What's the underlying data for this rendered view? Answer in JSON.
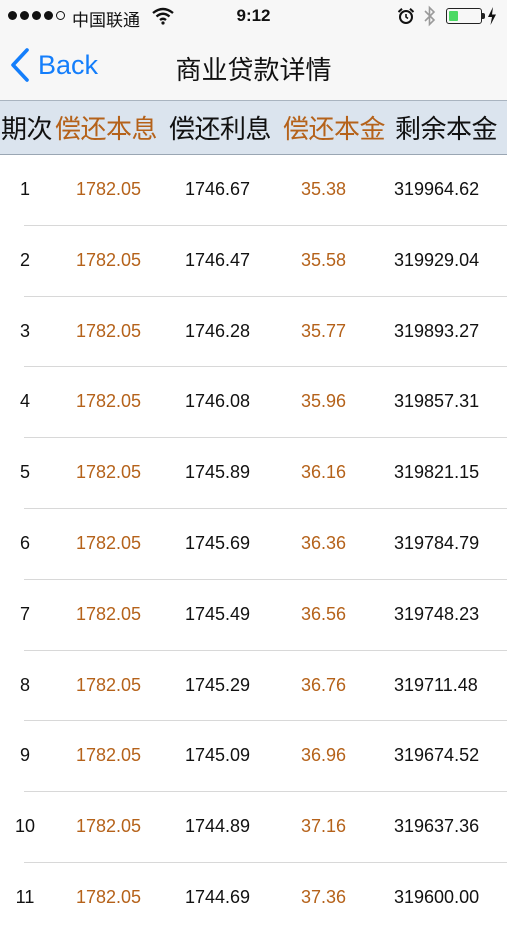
{
  "status_bar": {
    "carrier": "中国联通",
    "time": "9:12"
  },
  "nav": {
    "back_label": "Back",
    "title": "商业贷款详情"
  },
  "table": {
    "headers": {
      "period": "期次",
      "payment": "偿还本息",
      "interest": "偿还利息",
      "principal": "偿还本金",
      "remaining": "剩余本金"
    },
    "rows": [
      {
        "period": "1",
        "payment": "1782.05",
        "interest": "1746.67",
        "principal": "35.38",
        "remaining": "319964.62"
      },
      {
        "period": "2",
        "payment": "1782.05",
        "interest": "1746.47",
        "principal": "35.58",
        "remaining": "319929.04"
      },
      {
        "period": "3",
        "payment": "1782.05",
        "interest": "1746.28",
        "principal": "35.77",
        "remaining": "319893.27"
      },
      {
        "period": "4",
        "payment": "1782.05",
        "interest": "1746.08",
        "principal": "35.96",
        "remaining": "319857.31"
      },
      {
        "period": "5",
        "payment": "1782.05",
        "interest": "1745.89",
        "principal": "36.16",
        "remaining": "319821.15"
      },
      {
        "period": "6",
        "payment": "1782.05",
        "interest": "1745.69",
        "principal": "36.36",
        "remaining": "319784.79"
      },
      {
        "period": "7",
        "payment": "1782.05",
        "interest": "1745.49",
        "principal": "36.56",
        "remaining": "319748.23"
      },
      {
        "period": "8",
        "payment": "1782.05",
        "interest": "1745.29",
        "principal": "36.76",
        "remaining": "319711.48"
      },
      {
        "period": "9",
        "payment": "1782.05",
        "interest": "1745.09",
        "principal": "36.96",
        "remaining": "319674.52"
      },
      {
        "period": "10",
        "payment": "1782.05",
        "interest": "1744.89",
        "principal": "37.16",
        "remaining": "319637.36"
      },
      {
        "period": "11",
        "payment": "1782.05",
        "interest": "1744.69",
        "principal": "37.36",
        "remaining": "319600.00"
      }
    ]
  }
}
